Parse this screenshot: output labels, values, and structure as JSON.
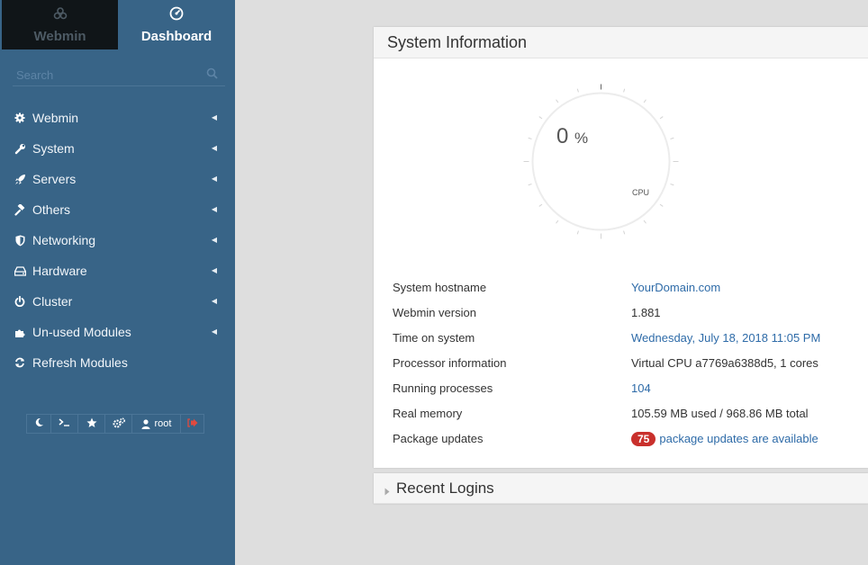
{
  "sidebar": {
    "switch": {
      "webmin_label": "Webmin",
      "dashboard_label": "Dashboard"
    },
    "search_placeholder": "Search",
    "items": [
      {
        "label": "Webmin",
        "icon": "gear-icon"
      },
      {
        "label": "System",
        "icon": "wrench-icon"
      },
      {
        "label": "Servers",
        "icon": "rocket-icon"
      },
      {
        "label": "Others",
        "icon": "gavel-icon"
      },
      {
        "label": "Networking",
        "icon": "shield-icon"
      },
      {
        "label": "Hardware",
        "icon": "drive-icon"
      },
      {
        "label": "Cluster",
        "icon": "power-icon"
      },
      {
        "label": "Un-used Modules",
        "icon": "puzzle-icon"
      },
      {
        "label": "Refresh Modules",
        "icon": "refresh-icon"
      }
    ],
    "toolbar": {
      "user_label": "root"
    }
  },
  "system_info": {
    "title": "System Information",
    "gauge": {
      "value": "0",
      "unit": "%",
      "label": "CPU"
    },
    "rows": [
      {
        "key": "System hostname",
        "value": "YourDomain.com"
      },
      {
        "key": "Webmin version",
        "value": "1.881"
      },
      {
        "key": "Time on system",
        "value": "Wednesday, July 18, 2018 11:05 PM"
      },
      {
        "key": "Processor information",
        "value": "Virtual CPU a7769a6388d5, 1 cores"
      },
      {
        "key": "Running processes",
        "value": "104"
      },
      {
        "key": "Real memory",
        "value": "105.59 MB used / 968.86 MB total"
      },
      {
        "key": "Package updates",
        "badge": "75",
        "value": "package updates are available"
      }
    ]
  },
  "recent_logins": {
    "title": "Recent Logins"
  },
  "colors": {
    "sidebar_bg": "#386487",
    "link": "#2e6ba8",
    "badge": "#c9302c"
  }
}
